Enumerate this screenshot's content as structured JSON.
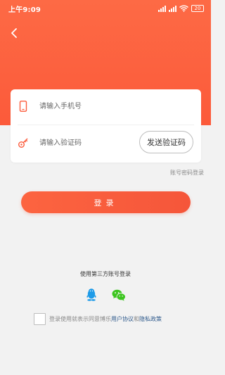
{
  "colors": {
    "brand": "#fc5a3a",
    "page_background": "#f2f2f2",
    "link": "#2f5a8c",
    "qq": "#1e9be8",
    "wechat": "#3cc51f"
  },
  "status_bar": {
    "time": "上午9:09",
    "battery": "20",
    "icons": [
      "signal-icon",
      "signal-icon",
      "wifi-icon",
      "battery-icon"
    ]
  },
  "nav": {
    "back_icon": "chevron-left-icon"
  },
  "form": {
    "phone": {
      "icon": "phone-icon",
      "placeholder": "请输入手机号",
      "value": ""
    },
    "code": {
      "icon": "key-icon",
      "placeholder": "请输入验证码",
      "value": "",
      "send_button": "发送验证码"
    }
  },
  "password_login_link": "账号密码登录",
  "login_button": "登录",
  "third_party": {
    "title": "使用第三方账号登录",
    "providers": [
      {
        "name": "qq",
        "icon": "qq-icon"
      },
      {
        "name": "wechat",
        "icon": "wechat-icon"
      }
    ]
  },
  "agreement": {
    "checked": false,
    "prefix": "登录使用就表示同意博乐",
    "user_agreement": "用户协议",
    "and": "和",
    "privacy_policy": "隐私政策"
  }
}
